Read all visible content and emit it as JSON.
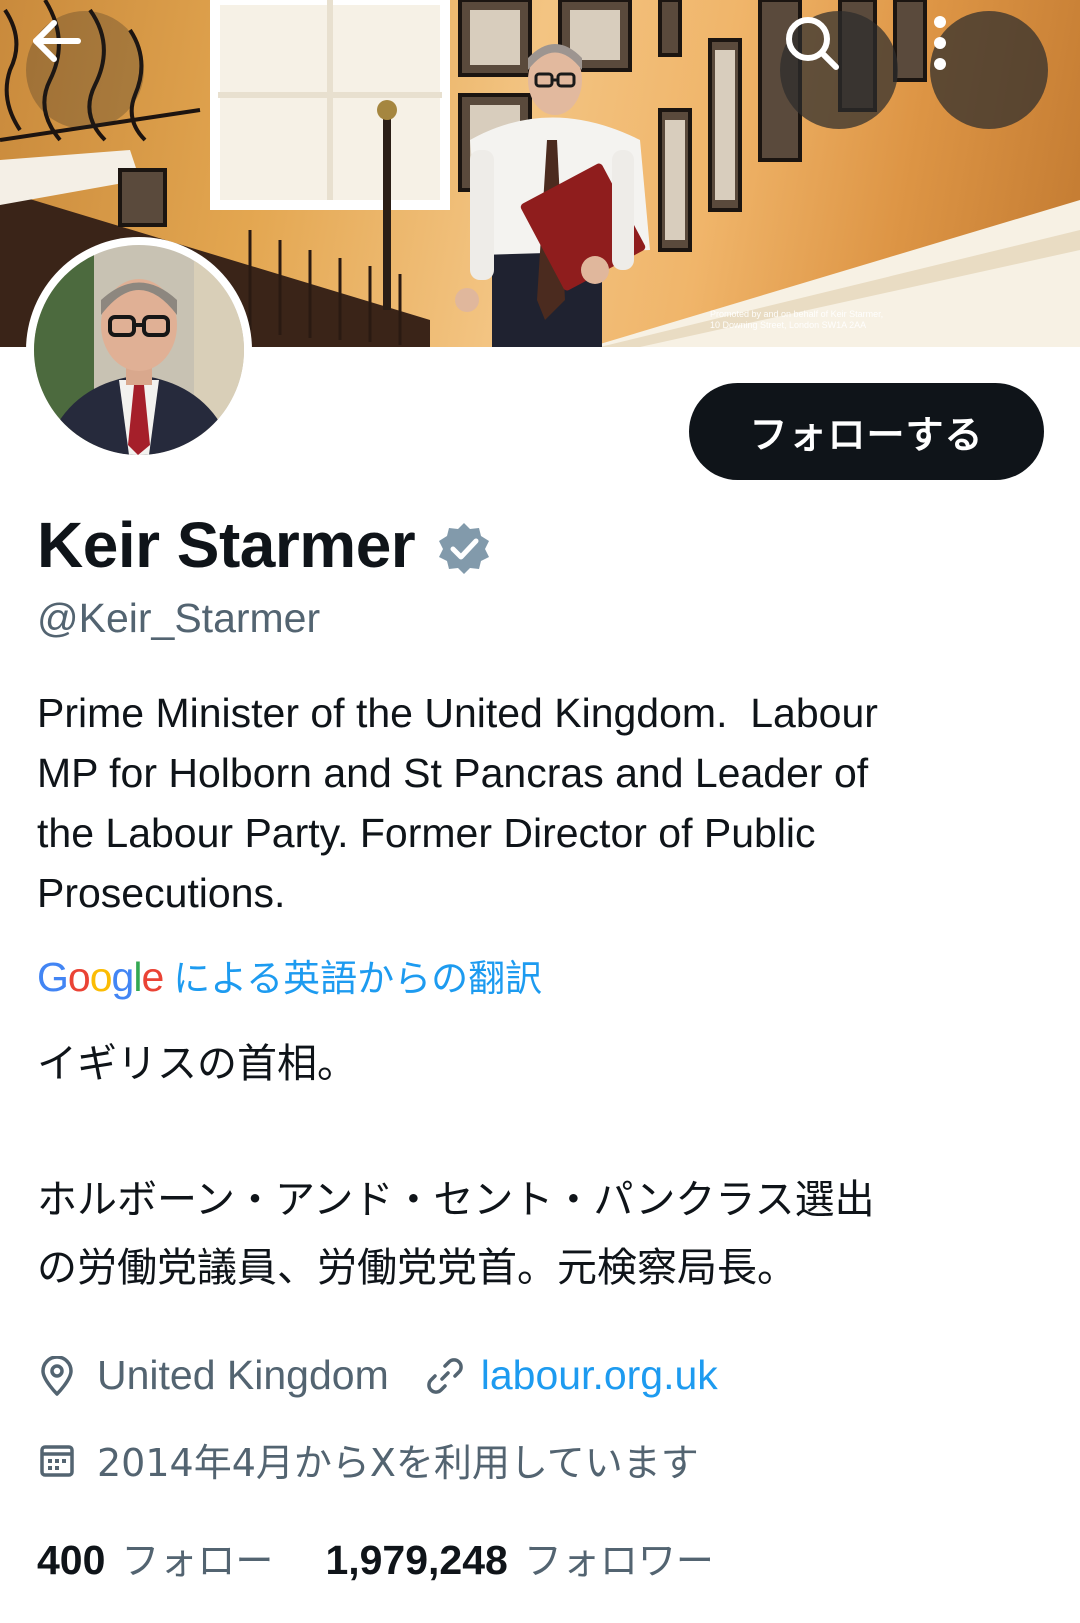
{
  "banner": {
    "promo_line1": "Promoted by and on behalf of Keir Starmer,",
    "promo_line2": "10 Downing Street, London SW1A 2AA"
  },
  "header": {
    "back_icon": "arrow-left-icon",
    "search_icon": "search-icon",
    "more_icon": "more-vertical-icon"
  },
  "profile": {
    "follow_label": "フォローする",
    "display_name": "Keir Starmer",
    "verified_color": "#829aab",
    "handle": "@Keir_Starmer",
    "bio": "Prime Minister of the United Kingdom.  Labour\nMP for Holborn and St Pancras and Leader of\nthe Labour Party. Former Director of Public\nProsecutions.",
    "translate_provider": "Google",
    "translate_label": "による英語からの翻訳",
    "translated_bio": "イギリスの首相。\n\nホルボーン・アンド・セント・パンクラス選出\nの労働党議員、労働党党首。元検察局長。",
    "location": "United Kingdom",
    "website": "labour.org.uk",
    "joined": "2014年4月からXを利用しています",
    "following_count": "400",
    "following_label": "フォロー",
    "followers_count": "1,979,248",
    "followers_label": "フォロワー"
  },
  "colors": {
    "accent": "#1d9bf0",
    "text_primary": "#0f1419",
    "text_secondary": "#536471"
  }
}
